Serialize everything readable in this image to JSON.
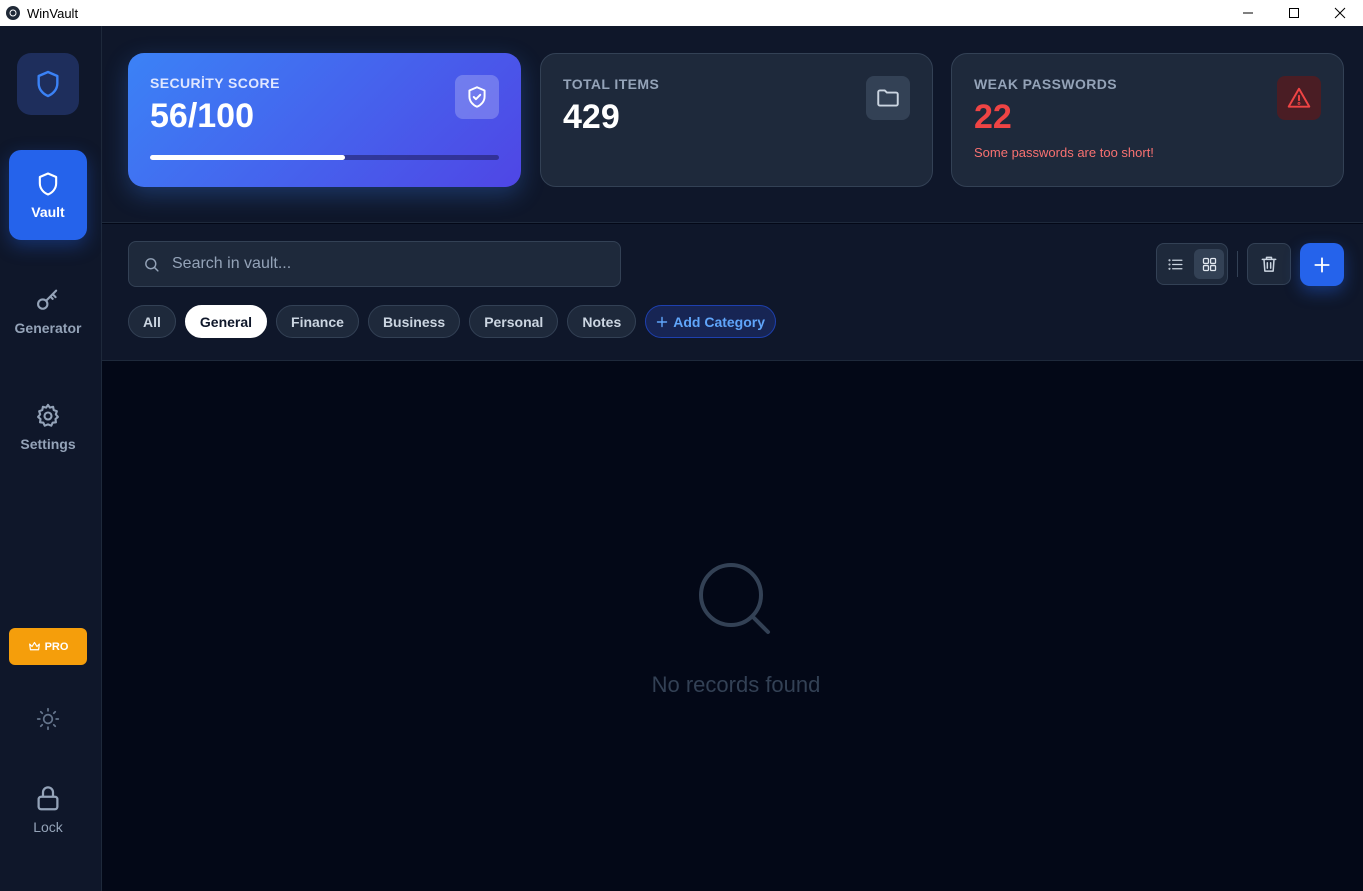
{
  "window": {
    "title": "WinVault"
  },
  "sidebar": {
    "items": [
      {
        "label": "Vault",
        "icon": "shield-icon",
        "active": true
      },
      {
        "label": "Generator",
        "icon": "key-icon",
        "active": false
      },
      {
        "label": "Settings",
        "icon": "gear-icon",
        "active": false
      }
    ],
    "pro_label": "PRO",
    "lock_label": "Lock"
  },
  "stats": {
    "security": {
      "label": "SECURİTY SCORE",
      "value": "56/100",
      "progress": 0.56
    },
    "total": {
      "label": "TOTAL ITEMS",
      "value": "429"
    },
    "weak": {
      "label": "WEAK PASSWORDS",
      "value": "22",
      "note": "Some passwords are too short!"
    }
  },
  "search": {
    "placeholder": "Search in vault..."
  },
  "categories": [
    "All",
    "General",
    "Finance",
    "Business",
    "Personal",
    "Notes"
  ],
  "selected_category": "General",
  "add_category_label": "Add Category",
  "empty_state": {
    "text": "No records found"
  },
  "colors": {
    "accent": "#2563eb",
    "danger": "#ef4444",
    "pro": "#f59e0b",
    "background": "#030817",
    "panel": "#0f172a"
  }
}
